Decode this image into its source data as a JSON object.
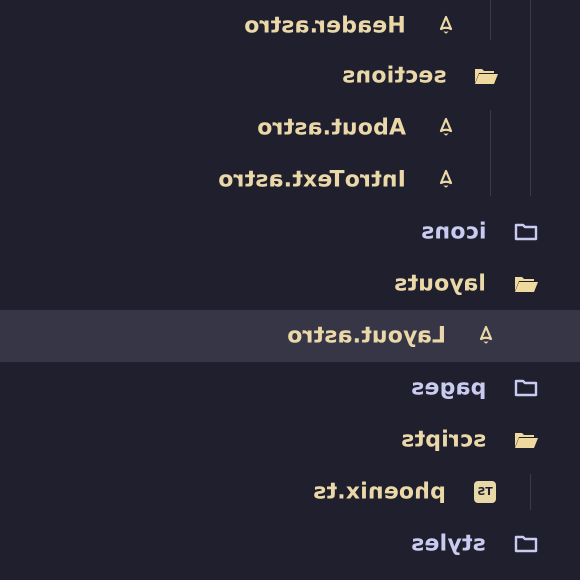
{
  "colors": {
    "background": "#1f1f2d",
    "selected_row": "#363646",
    "file_text": "#ebd8a8",
    "folder_text": "#c9cbf0",
    "open_folder_icon": "#f0d99f",
    "closed_folder_icon": "#c9cbf0",
    "guide_line": "#3a3a4c"
  },
  "tree": [
    {
      "label": "Header.astro",
      "kind": "file",
      "icon": "astro-icon"
    },
    {
      "label": "sections",
      "kind": "folder-open",
      "icon": "folder-open-icon"
    },
    {
      "label": "About.astro",
      "kind": "file",
      "icon": "astro-icon"
    },
    {
      "label": "IntroText.astro",
      "kind": "file",
      "icon": "astro-icon"
    },
    {
      "label": "icons",
      "kind": "folder-closed",
      "icon": "folder-icon"
    },
    {
      "label": "layouts",
      "kind": "folder-open",
      "icon": "folder-open-icon"
    },
    {
      "label": "Layout.astro",
      "kind": "file",
      "icon": "astro-icon",
      "selected": true
    },
    {
      "label": "pages",
      "kind": "folder-closed",
      "icon": "folder-icon"
    },
    {
      "label": "scripts",
      "kind": "folder-open",
      "icon": "folder-open-icon"
    },
    {
      "label": "phoenix.ts",
      "kind": "file",
      "icon": "typescript-icon",
      "badge": "TS"
    },
    {
      "label": "styles",
      "kind": "folder-closed",
      "icon": "folder-icon"
    }
  ]
}
